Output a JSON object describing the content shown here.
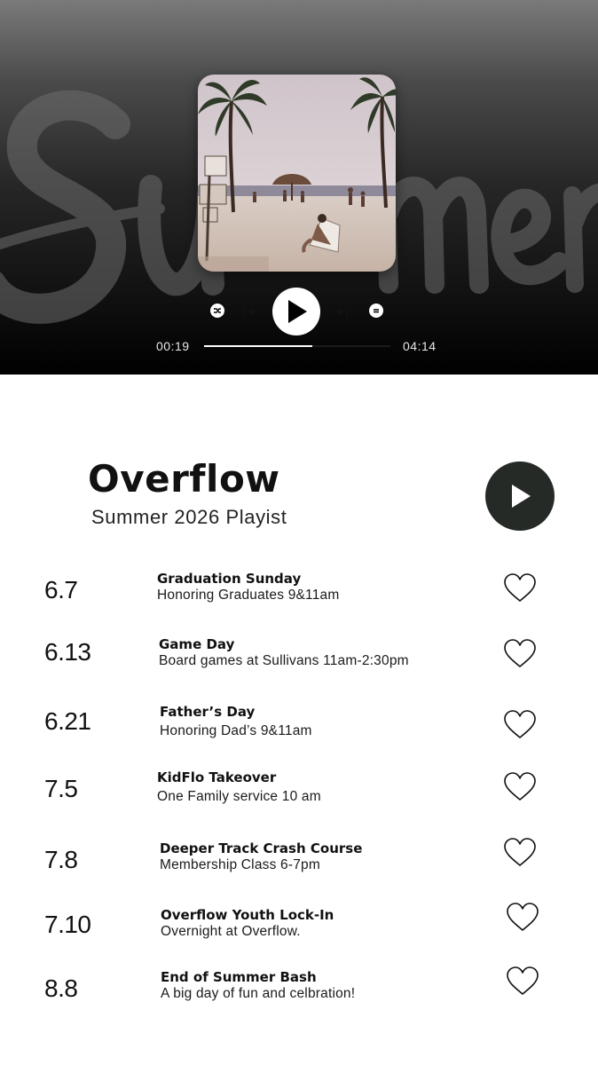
{
  "player": {
    "background_word": "Summer",
    "elapsed": "00:19",
    "total": "04:14",
    "progress": 0.58,
    "icons": [
      "shuffle-icon",
      "previous-icon",
      "play-icon",
      "next-icon",
      "repeat-icon"
    ]
  },
  "playlist": {
    "title": "Overflow",
    "subtitle": "Summer 2026 Playist"
  },
  "tracks": [
    {
      "date": "6.7",
      "name": "Graduation Sunday",
      "desc": "Honoring Graduates 9&11am"
    },
    {
      "date": "6.13",
      "name": "Game Day",
      "desc": "Board games at Sullivans 11am-2:30pm"
    },
    {
      "date": "6.21",
      "name": "Father’s Day",
      "desc": "Honoring Dad’s 9&11am"
    },
    {
      "date": "7.5",
      "name": "KidFlo Takeover",
      "desc": "One Family service 10 am"
    },
    {
      "date": "7.8",
      "name": "Deeper Track Crash Course",
      "desc": "Membership Class 6-7pm"
    },
    {
      "date": "7.10",
      "name": "Overflow Youth Lock-In",
      "desc": "Overnight at Overflow."
    },
    {
      "date": "8.8",
      "name": "End of Summer Bash",
      "desc": "A big day of fun and celbration!"
    }
  ],
  "colors": {
    "big_play_bg": "#252a27",
    "accent": "#ffffff"
  }
}
